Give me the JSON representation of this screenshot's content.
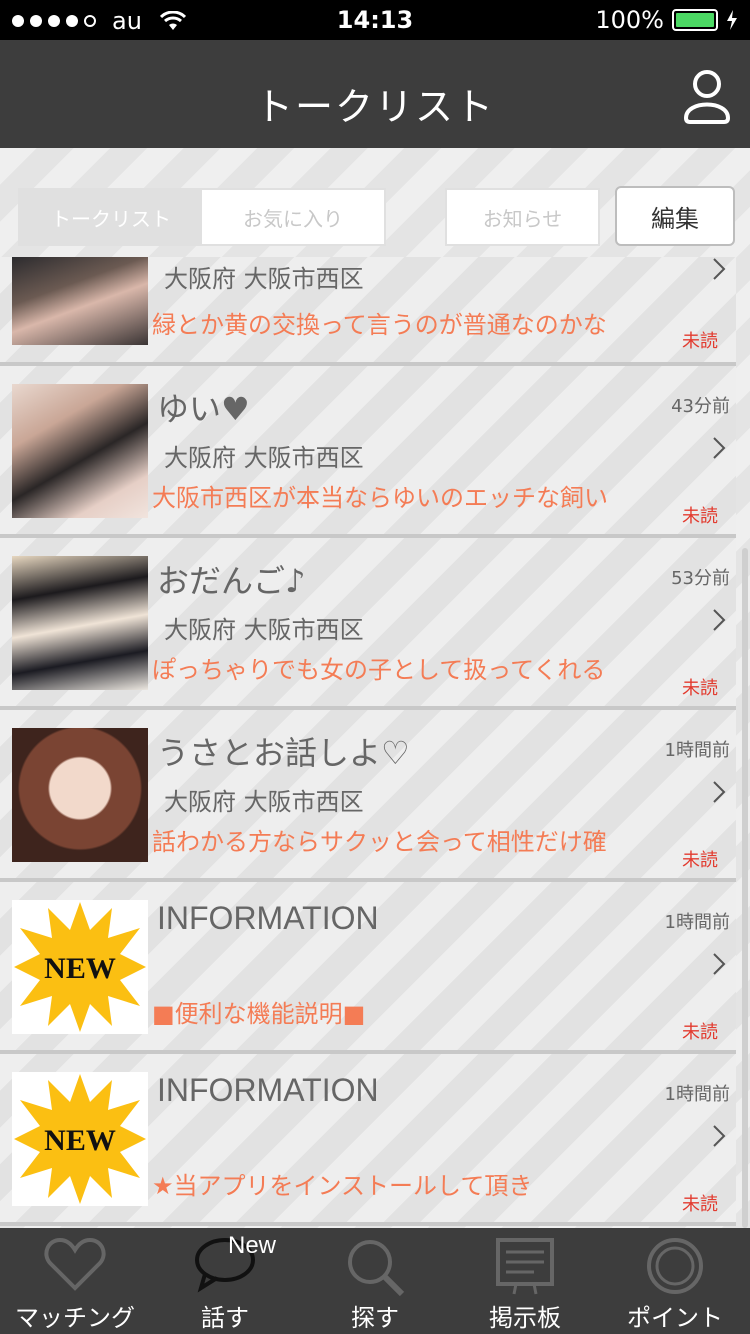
{
  "status_bar": {
    "carrier": "au",
    "time": "14:13",
    "battery": "100%"
  },
  "header": {
    "title": "トークリスト"
  },
  "segment": {
    "tabs": [
      "トークリスト",
      "お気に入り"
    ],
    "notice": "お知らせ",
    "edit": "編集"
  },
  "items": [
    {
      "name": "",
      "time": "",
      "location": "大阪府 大阪市西区",
      "message": "緑とか黄の交換って言うのが普通なのかな",
      "unread": "未読"
    },
    {
      "name": "ゆい♥",
      "time": "43分前",
      "location": "大阪府 大阪市西区",
      "message": "大阪市西区が本当ならゆいのエッチな飼い",
      "unread": "未読"
    },
    {
      "name": "おだんご♪",
      "time": "53分前",
      "location": "大阪府 大阪市西区",
      "message": "ぽっちゃりでも女の子として扱ってくれる",
      "unread": "未読"
    },
    {
      "name": "うさとお話しよ♡",
      "time": "1時間前",
      "location": "大阪府 大阪市西区",
      "message": "話わかる方ならサクッと会って相性だけ確",
      "unread": "未読"
    },
    {
      "name": "INFORMATION",
      "time": "1時間前",
      "location": "",
      "message": "■便利な機能説明■",
      "unread": "未読",
      "badge": "NEW"
    },
    {
      "name": "INFORMATION",
      "time": "1時間前",
      "location": "",
      "message": "★当アプリをインストールして頂き",
      "unread": "未読",
      "badge": "NEW"
    }
  ],
  "tabbar": [
    {
      "label": "マッチング",
      "icon": "heart-icon"
    },
    {
      "label": "話す",
      "icon": "speech-bubble-icon",
      "tag": "New"
    },
    {
      "label": "探す",
      "icon": "search-icon"
    },
    {
      "label": "掲示板",
      "icon": "board-icon"
    },
    {
      "label": "ポイント",
      "icon": "coin-icon"
    }
  ],
  "colors": {
    "header": "#3d3d3d",
    "message": "#f47c55",
    "unread": "#e23b2f",
    "battery": "#4cd964"
  }
}
